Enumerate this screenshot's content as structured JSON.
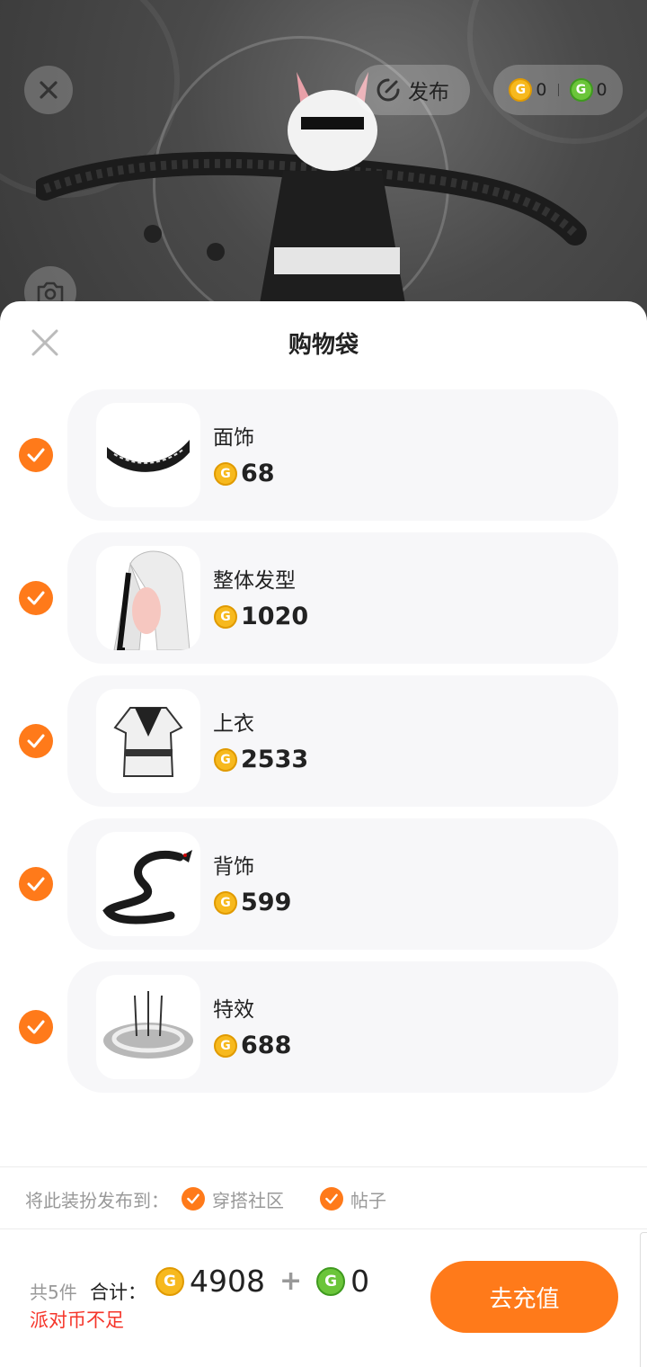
{
  "top_bar": {
    "publish_label": "发布",
    "gold_balance": "0",
    "green_balance": "0"
  },
  "sheet": {
    "title": "购物袋",
    "items": [
      {
        "name": "面饰",
        "price": "68",
        "checked": true,
        "thumb": "face-accessory"
      },
      {
        "name": "整体发型",
        "price": "1020",
        "checked": true,
        "thumb": "hairstyle"
      },
      {
        "name": "上衣",
        "price": "2533",
        "checked": true,
        "thumb": "top"
      },
      {
        "name": "背饰",
        "price": "599",
        "checked": true,
        "thumb": "back-accessory"
      },
      {
        "name": "特效",
        "price": "688",
        "checked": true,
        "thumb": "effect"
      }
    ]
  },
  "publish_to": {
    "label": "将此装扮发布到：",
    "options": [
      {
        "label": "穿搭社区",
        "checked": true
      },
      {
        "label": "帖子",
        "checked": true
      }
    ]
  },
  "footer": {
    "count_label": "共5件",
    "total_label": "合计：",
    "gold_total": "4908",
    "plus": "+",
    "green_total": "0",
    "warning": "派对币不足",
    "recharge_label": "去充值"
  },
  "colors": {
    "accent": "#ff7a1a",
    "warning": "#f5352a",
    "gold_coin": "#f7b91e",
    "green_coin": "#6bc53a"
  }
}
